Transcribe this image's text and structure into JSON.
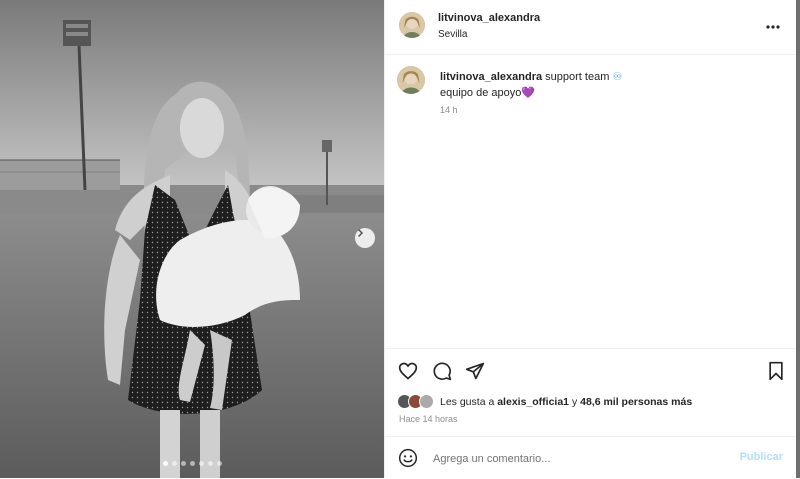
{
  "post": {
    "author": "litvinova_alexandra",
    "location": "Sevilla"
  },
  "caption": {
    "author": "litvinova_alexandra",
    "text_line1": "support team",
    "text_line2": "equipo de apoyo",
    "emoji_line1": "♾",
    "emoji_line2": "💜",
    "time": "14 h"
  },
  "likes": {
    "prefix": "Les gusta a",
    "user": "alexis_officia1",
    "connector": "y",
    "others": "48,6 mil personas más"
  },
  "posted_ago": "Hace 14 horas",
  "comment": {
    "placeholder": "Agrega un comentario...",
    "publish_label": "Publicar"
  },
  "carousel": {
    "total_slides": 7,
    "current_slide": 1
  },
  "colors": {
    "link_blue_disabled": "#b2dffc",
    "text": "#262626",
    "muted": "#8e8e8e"
  }
}
